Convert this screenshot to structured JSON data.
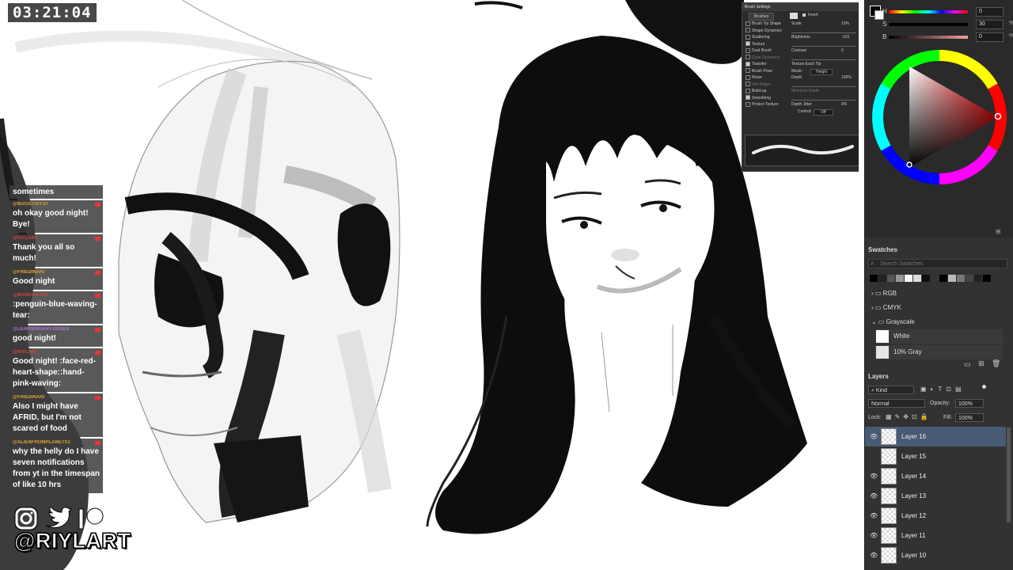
{
  "timer": "03:21:04",
  "chat": {
    "first": "sometimes",
    "messages": [
      {
        "user": "@BUGSTUFF27",
        "text": "oh okay good night! Bye!"
      },
      {
        "user": "@RIYLART",
        "text": "Thank you all so much!"
      },
      {
        "user": "@FRIEDINARI",
        "text": "Good night"
      },
      {
        "user": "@BUGSTUFF27",
        "text": ":penguin-blue-waving-tear:"
      },
      {
        "user": "@LEARNINGART-GG3EX",
        "text": "good night!"
      },
      {
        "user": "@RIYLART",
        "text": "Good night! :face-red-heart-shape::hand-pink-waving:"
      },
      {
        "user": "@FRIEDINARI",
        "text": "Also I might have AFRID, but I'm not scared of food"
      },
      {
        "user": "@ALIENFROMPLANETS1",
        "text": "why the helly do I have seven notifications from yt in the timespan of like 10 hrs"
      }
    ]
  },
  "social": {
    "handle": "@RIYLART"
  },
  "brush_settings": {
    "title": "Brush Settings",
    "brushes_btn": "Brushes",
    "invert_label": "Invert",
    "rows": [
      {
        "label": "Brush Tip Shape",
        "checked": false
      },
      {
        "label": "Shape Dynamics",
        "checked": false
      },
      {
        "label": "Scattering",
        "checked": false
      },
      {
        "label": "Texture",
        "checked": true
      },
      {
        "label": "Dual Brush",
        "checked": false
      },
      {
        "label": "Color Dynamics",
        "checked": false
      },
      {
        "label": "Transfer",
        "checked": true
      },
      {
        "label": "Brush Pose",
        "checked": false
      },
      {
        "label": "Noise",
        "checked": false
      },
      {
        "label": "Wet Edges",
        "checked": false
      },
      {
        "label": "Build-up",
        "checked": false
      },
      {
        "label": "Smoothing",
        "checked": true
      },
      {
        "label": "Protect Texture",
        "checked": false
      }
    ],
    "params": [
      {
        "label": "Scale",
        "value": "13%"
      },
      {
        "label": "Brightness",
        "value": "-103"
      },
      {
        "label": "Contrast",
        "value": "0"
      },
      {
        "label": "Texture Each Tip",
        "value": ""
      },
      {
        "label": "Mode:",
        "value": "Height"
      },
      {
        "label": "Depth",
        "value": "100%"
      },
      {
        "label": "Minimum Depth",
        "value": ""
      },
      {
        "label": "Depth Jitter",
        "value": "0%"
      },
      {
        "label": "Control:",
        "value": "Off"
      }
    ]
  },
  "color": {
    "h": {
      "label": "H",
      "value": "0",
      "unit": ""
    },
    "s": {
      "label": "S",
      "value": "30",
      "unit": "%"
    },
    "b": {
      "label": "B",
      "value": "0",
      "unit": "%"
    }
  },
  "swatches": {
    "title": "Swatches",
    "search_placeholder": "Search Swatches",
    "groups": [
      "RGB",
      "CMYK",
      "Grayscale"
    ],
    "items": [
      {
        "name": "White",
        "color": "#ffffff"
      },
      {
        "name": "10% Gray",
        "color": "#e6e6e6"
      }
    ]
  },
  "layers": {
    "title": "Layers",
    "kind": "Kind",
    "blend_mode": "Normal",
    "opacity_label": "Opacity:",
    "opacity": "100%",
    "lock_label": "Lock:",
    "fill_label": "Fill:",
    "fill": "100%",
    "items": [
      {
        "name": "Layer 16",
        "visible": true,
        "selected": true
      },
      {
        "name": "Layer 15",
        "visible": false,
        "selected": false
      },
      {
        "name": "Layer 14",
        "visible": true,
        "selected": false
      },
      {
        "name": "Layer 13",
        "visible": true,
        "selected": false
      },
      {
        "name": "Layer 12",
        "visible": true,
        "selected": false
      },
      {
        "name": "Layer 11",
        "visible": true,
        "selected": false
      },
      {
        "name": "Layer 10",
        "visible": true,
        "selected": false
      }
    ]
  }
}
